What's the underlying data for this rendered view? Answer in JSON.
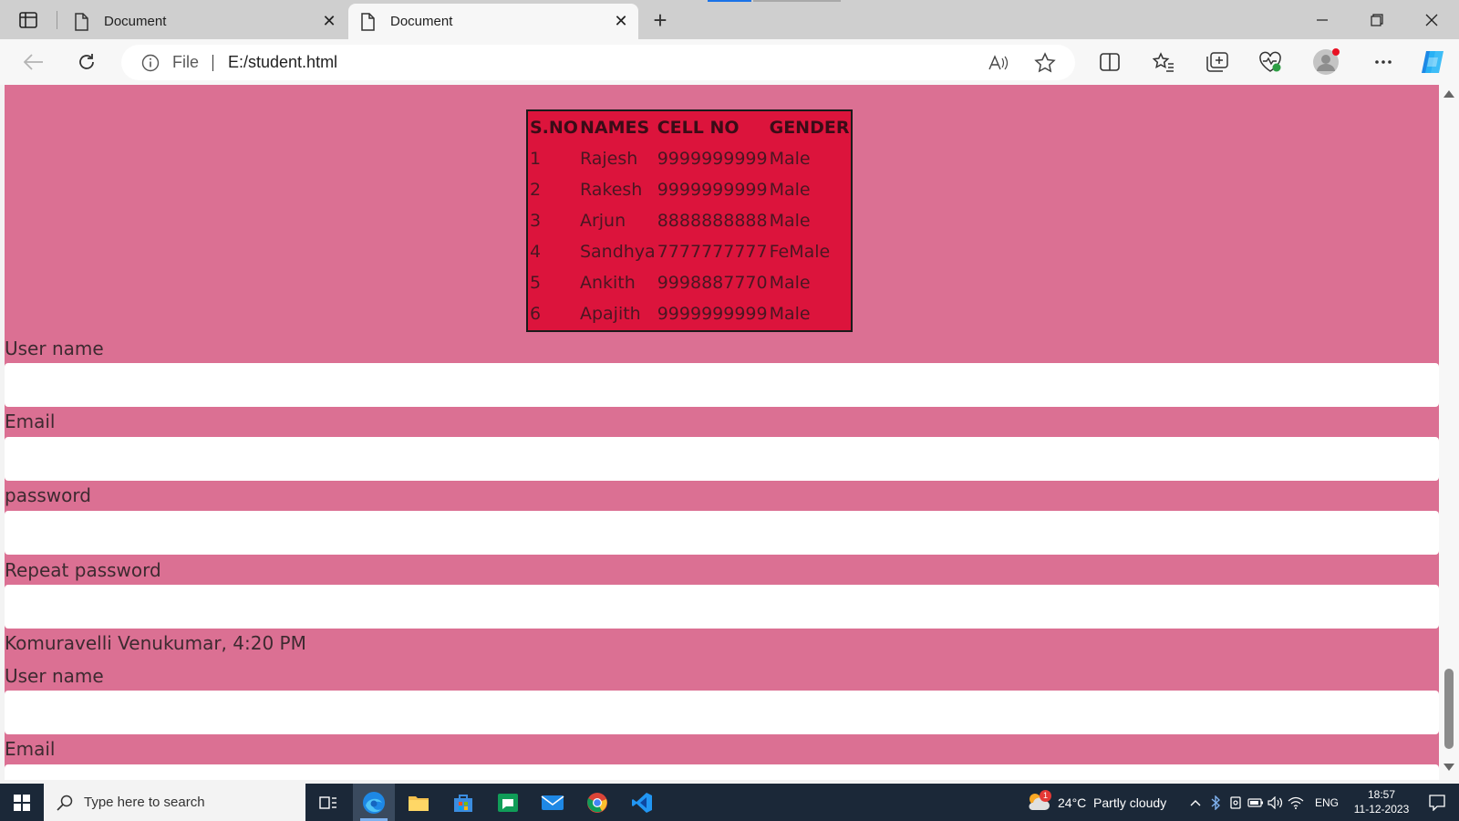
{
  "browser": {
    "tabs": [
      {
        "label": "Document"
      },
      {
        "label": "Document"
      }
    ],
    "address": {
      "scheme_label": "File",
      "url": "E:/student.html"
    }
  },
  "page": {
    "table": {
      "headers": [
        "S.NO",
        "NAMES",
        "CELL NO",
        "GENDER"
      ],
      "rows": [
        [
          "1",
          "Rajesh",
          "9999999999",
          "Male"
        ],
        [
          "2",
          "Rakesh",
          "9999999999",
          "Male"
        ],
        [
          "3",
          "Arjun",
          "8888888888",
          "Male"
        ],
        [
          "4",
          "Sandhya",
          "7777777777",
          "FeMale"
        ],
        [
          "5",
          "Ankith",
          "9998887770",
          "Male"
        ],
        [
          "6",
          "Apajith",
          "9999999999",
          "Male"
        ]
      ]
    },
    "form": {
      "username_label": "User name",
      "email_label": "Email",
      "password_label": "password",
      "repeat_password_label": "Repeat password"
    },
    "chat_meta": "Komuravelli Venukumar, 4:20 PM",
    "form2": {
      "username_label": "User name",
      "email_label": "Email"
    },
    "background_color": "#db7093",
    "table_color": "#dc143c"
  },
  "taskbar": {
    "search_placeholder": "Type here to search",
    "weather": "24°C  Partly cloudy",
    "language": "ENG",
    "time": "18:57",
    "date": "11-12-2023",
    "weather_badge": "1"
  }
}
